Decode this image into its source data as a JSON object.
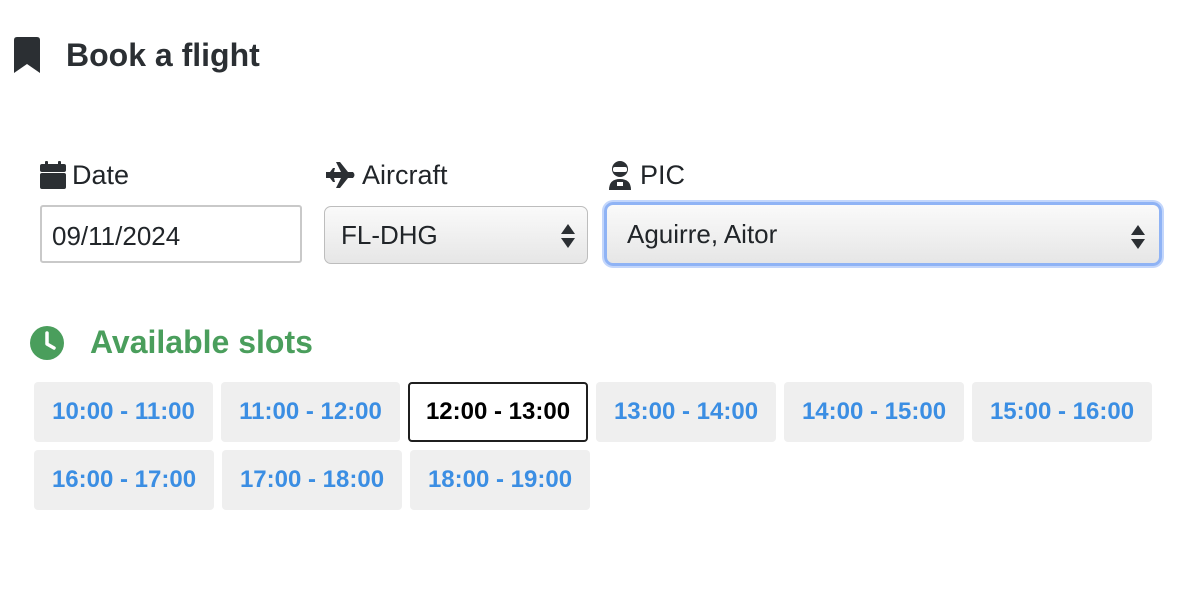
{
  "header": {
    "title": "Book a flight",
    "icon": "bookmark-icon"
  },
  "form": {
    "date": {
      "label": "Date",
      "icon": "calendar-icon",
      "value": "09/11/2024"
    },
    "aircraft": {
      "label": "Aircraft",
      "icon": "plane-icon",
      "selected": "FL-DHG"
    },
    "pic": {
      "label": "PIC",
      "icon": "pilot-icon",
      "selected": "Aguirre, Aitor"
    }
  },
  "slots": {
    "title": "Available slots",
    "icon": "clock-icon",
    "items": [
      {
        "label": "10:00 - 11:00",
        "selected": false
      },
      {
        "label": "11:00 - 12:00",
        "selected": false
      },
      {
        "label": "12:00 - 13:00",
        "selected": true
      },
      {
        "label": "13:00 - 14:00",
        "selected": false
      },
      {
        "label": "14:00 - 15:00",
        "selected": false
      },
      {
        "label": "15:00 - 16:00",
        "selected": false
      },
      {
        "label": "16:00 - 17:00",
        "selected": false
      },
      {
        "label": "17:00 - 18:00",
        "selected": false
      },
      {
        "label": "18:00 - 19:00",
        "selected": false
      }
    ]
  },
  "colors": {
    "slot_text": "#3b8ee3",
    "slots_title": "#4a9e5c",
    "focus_ring": "#8fb3f5"
  }
}
